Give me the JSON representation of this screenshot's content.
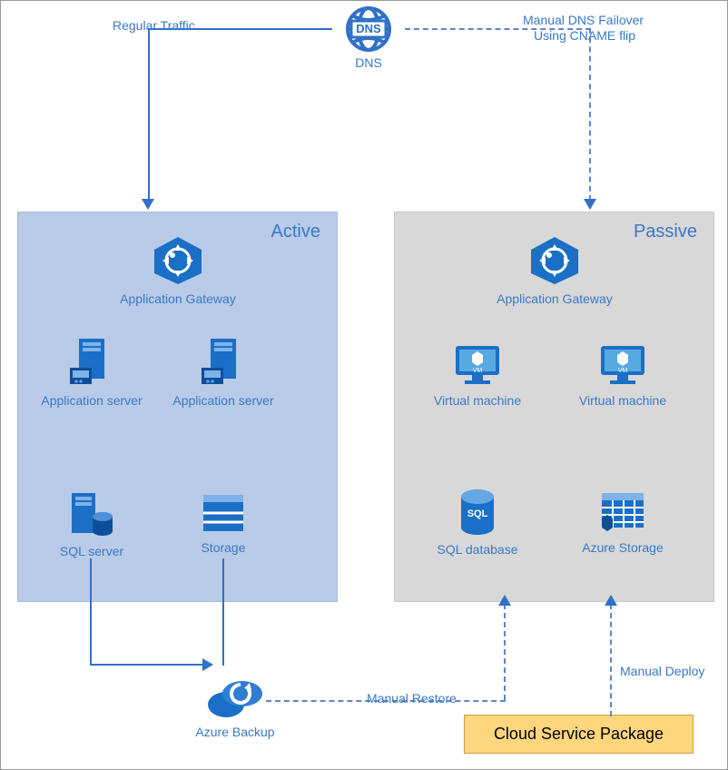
{
  "colors": {
    "azure_blue": "#3071c7",
    "active_bg": "#b9cbe8",
    "passive_bg": "#d8d8d8",
    "gold": "#fed67e"
  },
  "dns": {
    "title": "DNS",
    "label": "DNS"
  },
  "left_traffic": "Regular Traffic",
  "right_traffic_line1": "Manual DNS Failover",
  "right_traffic_line2": "Using CNAME flip",
  "regions": {
    "active": {
      "title": "Active"
    },
    "passive": {
      "title": "Passive"
    }
  },
  "nodes": {
    "app_gateway_active": "Application Gateway",
    "app_gateway_passive": "Application Gateway",
    "app_server_1": "Application server",
    "app_server_2": "Application server",
    "vm_1": "Virtual machine",
    "vm_2": "Virtual machine",
    "sql_server": "SQL server",
    "storage": "Storage",
    "sql_database": "SQL database",
    "azure_storage": "Azure Storage",
    "azure_backup": "Azure Backup"
  },
  "flows": {
    "manual_restore": "Manual Restore",
    "manual_deploy": "Manual Deploy",
    "cloud_service_package": "Cloud Service Package"
  }
}
